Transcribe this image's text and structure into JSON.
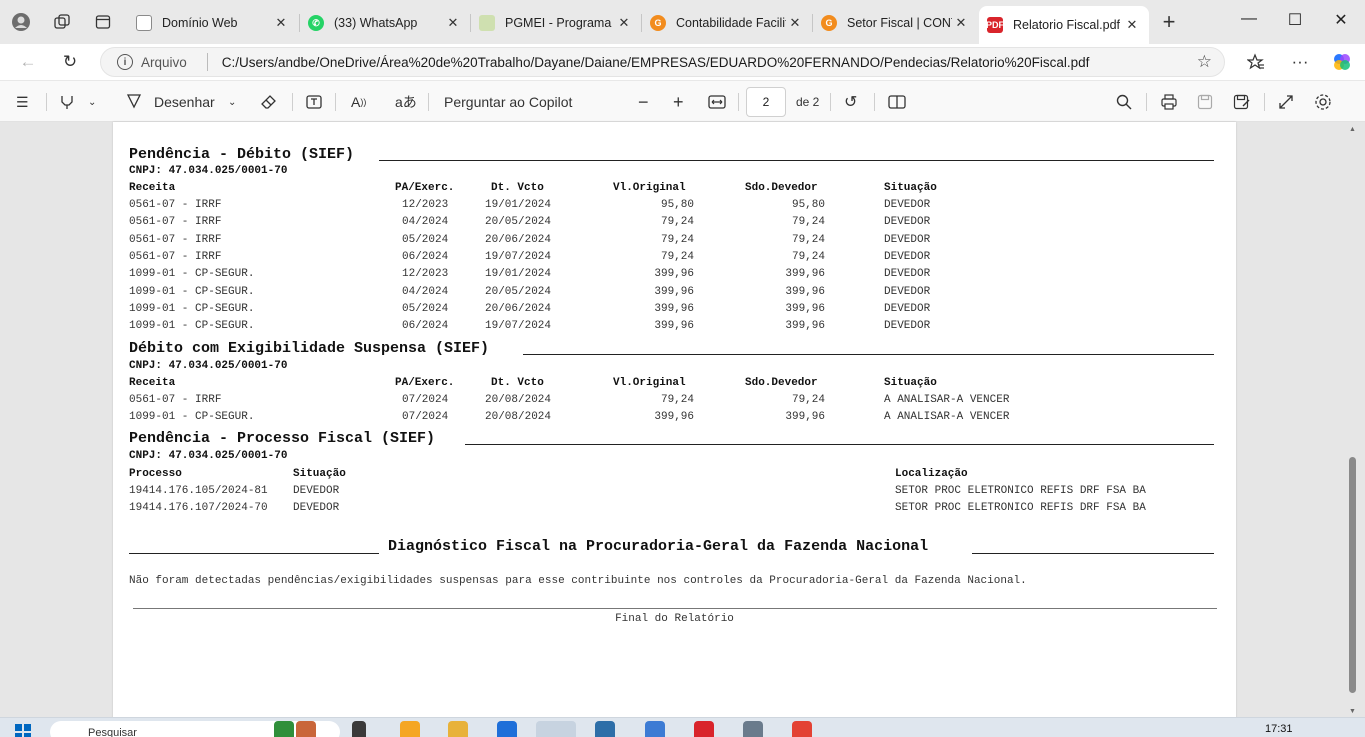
{
  "browser": {
    "tabs": [
      {
        "title": "Domínio Web",
        "favicon_color": "#8a8a8a",
        "active": false
      },
      {
        "title": "(33) WhatsApp",
        "favicon_color": "#25d366",
        "active": false
      },
      {
        "title": "PGMEI - Programa G",
        "favicon_color": "#9bbf5a",
        "active": false
      },
      {
        "title": "Contabilidade Facilit",
        "favicon_color": "#f28c1e",
        "active": false
      },
      {
        "title": "Setor Fiscal | CONTA",
        "favicon_color": "#f28c1e",
        "active": false
      },
      {
        "title": "Relatorio Fiscal.pdf",
        "favicon_color": "#d9242b",
        "active": true
      }
    ],
    "new_tab_symbol": "+",
    "window": {
      "minimize": "—",
      "maximize": "☐",
      "close": "✕"
    },
    "address": {
      "scheme_label": "Arquivo",
      "url": "C:/Users/andbe/OneDrive/Área%20de%20Trabalho/Dayane/Daiane/EMPRESAS/EDUARDO%20FERNANDO/Pendecias/Relatorio%20Fiscal.pdf"
    }
  },
  "pdf_toolbar": {
    "draw_label": "Desenhar",
    "copilot_label": "Perguntar ao Copilot",
    "current_page": "2",
    "total_pages_label": "de 2"
  },
  "report": {
    "section1": {
      "title": "Pendência - Débito (SIEF)",
      "cnpj": "CNPJ: 47.034.025/0001-70",
      "headers": [
        "Receita",
        "PA/Exerc.",
        "Dt. Vcto",
        "Vl.Original",
        "Sdo.Devedor",
        "Situação"
      ],
      "rows": [
        [
          "0561-07 - IRRF",
          "12/2023",
          "19/01/2024",
          "95,80",
          "95,80",
          "DEVEDOR"
        ],
        [
          "0561-07 - IRRF",
          "04/2024",
          "20/05/2024",
          "79,24",
          "79,24",
          "DEVEDOR"
        ],
        [
          "0561-07 - IRRF",
          "05/2024",
          "20/06/2024",
          "79,24",
          "79,24",
          "DEVEDOR"
        ],
        [
          "0561-07 - IRRF",
          "06/2024",
          "19/07/2024",
          "79,24",
          "79,24",
          "DEVEDOR"
        ],
        [
          "1099-01 - CP-SEGUR.",
          "12/2023",
          "19/01/2024",
          "399,96",
          "399,96",
          "DEVEDOR"
        ],
        [
          "1099-01 - CP-SEGUR.",
          "04/2024",
          "20/05/2024",
          "399,96",
          "399,96",
          "DEVEDOR"
        ],
        [
          "1099-01 - CP-SEGUR.",
          "05/2024",
          "20/06/2024",
          "399,96",
          "399,96",
          "DEVEDOR"
        ],
        [
          "1099-01 - CP-SEGUR.",
          "06/2024",
          "19/07/2024",
          "399,96",
          "399,96",
          "DEVEDOR"
        ]
      ]
    },
    "section2": {
      "title": "Débito com Exigibilidade Suspensa (SIEF)",
      "cnpj": "CNPJ: 47.034.025/0001-70",
      "headers": [
        "Receita",
        "PA/Exerc.",
        "Dt. Vcto",
        "Vl.Original",
        "Sdo.Devedor",
        "Situação"
      ],
      "rows": [
        [
          "0561-07 - IRRF",
          "07/2024",
          "20/08/2024",
          "79,24",
          "79,24",
          "A ANALISAR-A VENCER"
        ],
        [
          "1099-01 - CP-SEGUR.",
          "07/2024",
          "20/08/2024",
          "399,96",
          "399,96",
          "A ANALISAR-A VENCER"
        ]
      ]
    },
    "section3": {
      "title": "Pendência - Processo Fiscal (SIEF)",
      "cnpj": "CNPJ: 47.034.025/0001-70",
      "headers": [
        "Processo",
        "Situação",
        "Localização"
      ],
      "rows": [
        [
          "19414.176.105/2024-81",
          "DEVEDOR",
          "SETOR PROC ELETRONICO REFIS DRF FSA BA"
        ],
        [
          "19414.176.107/2024-70",
          "DEVEDOR",
          "SETOR PROC ELETRONICO REFIS DRF FSA BA"
        ]
      ]
    },
    "section4": {
      "title": "Diagnóstico Fiscal na Procuradoria-Geral da Fazenda Nacional",
      "message": "Não foram detectadas pendências/exigibilidades suspensas para esse contribuinte nos controles da Procuradoria-Geral da Fazenda Nacional."
    },
    "footer": "Final do Relatório"
  },
  "taskbar": {
    "search_placeholder": "Pesquisar",
    "time": "17:31"
  }
}
